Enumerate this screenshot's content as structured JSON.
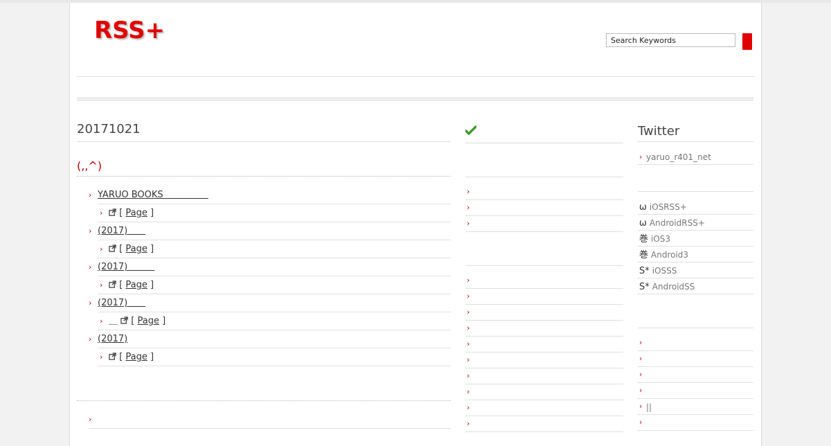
{
  "site": {
    "logo": "RSS+"
  },
  "search": {
    "placeholder": "Search Keywords"
  },
  "main": {
    "date": "20171021",
    "section_title": "(,,^)",
    "entries": [
      {
        "title": "YARUO BOOKS　　　　　",
        "sub_prefix": "",
        "page_label": "Page"
      },
      {
        "title": "(2017)　　",
        "sub_prefix": "",
        "page_label": "Page"
      },
      {
        "title": "(2017)　　　",
        "sub_prefix": "",
        "page_label": "Page"
      },
      {
        "title": "(2017)　　",
        "sub_prefix": "＿",
        "page_label": "Page"
      },
      {
        "title": "(2017)",
        "sub_prefix": "",
        "page_label": "Page"
      }
    ],
    "bracket_open": "[",
    "bracket_close": "]"
  },
  "sidebar_right": {
    "twitter_title": "Twitter",
    "twitter_user": "yaruo_r401_net",
    "apps": [
      {
        "glyph": "ω",
        "label": "iOSRSS+"
      },
      {
        "glyph": "ω",
        "label": "AndroidRSS+"
      },
      {
        "glyph": "巻",
        "label": "iOS3"
      },
      {
        "glyph": "巻",
        "label": "Android3"
      },
      {
        "glyph": "S*",
        "label": "iOSSS"
      },
      {
        "glyph": "S*",
        "label": "AndroidSS"
      }
    ],
    "lower_links": [
      "",
      "",
      "",
      "",
      "||",
      ""
    ]
  },
  "colors": {
    "accent": "#e00000",
    "check": "#3a9a2a"
  }
}
